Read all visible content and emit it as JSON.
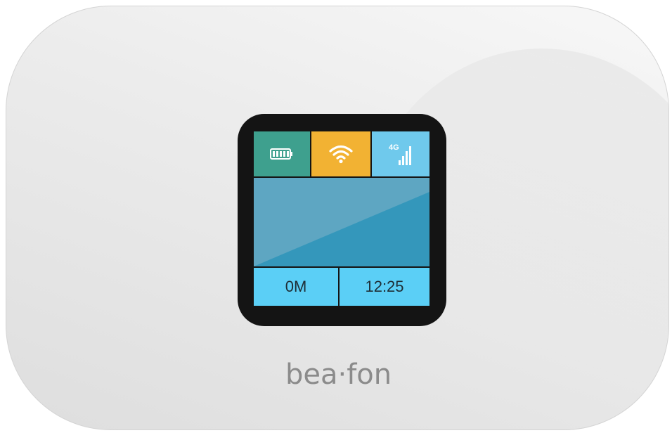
{
  "device": {
    "brand": "bea·fon"
  },
  "status_bar": {
    "battery_icon": "battery-full-icon",
    "wifi_icon": "wifi-icon",
    "network_label": "4G",
    "signal_icon": "signal-bars-icon"
  },
  "info": {
    "data_usage": "0M",
    "time": "12:25"
  },
  "colors": {
    "battery_tile": "#3ea08e",
    "wifi_tile": "#f2b233",
    "signal_tile": "#6fc9ec",
    "main_panel": "#5ea6c2",
    "bottom_tiles": "#5bcff6"
  }
}
